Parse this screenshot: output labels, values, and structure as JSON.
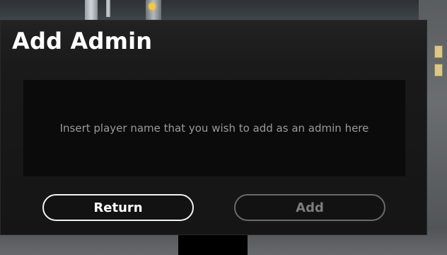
{
  "dialog": {
    "title": "Add Admin",
    "input": {
      "value": "",
      "placeholder": "Insert player name that you wish to add as an admin here"
    },
    "buttons": {
      "return_label": "Return",
      "add_label": "Add"
    }
  },
  "colors": {
    "dialog_background": "#181818",
    "input_background": "#0b0b0b",
    "return_border": "#f2f2f2",
    "add_border_disabled": "#6a6a6a"
  }
}
